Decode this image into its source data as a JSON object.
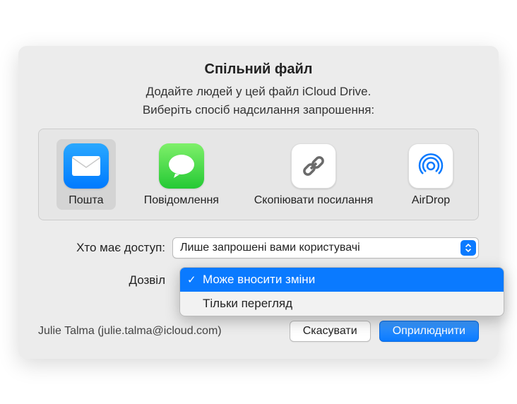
{
  "dialog": {
    "title": "Спільний файл",
    "subtitle": "Додайте людей у цей файл iCloud Drive.",
    "instruction": "Виберіть спосіб надсилання запрошення:"
  },
  "methods": [
    {
      "id": "mail",
      "label": "Пошта",
      "selected": true
    },
    {
      "id": "messages",
      "label": "Повідомлення",
      "selected": false
    },
    {
      "id": "copy-link",
      "label": "Скопіювати посилання",
      "selected": false
    },
    {
      "id": "airdrop",
      "label": "AirDrop",
      "selected": false
    }
  ],
  "access": {
    "label": "Хто має доступ:",
    "value": "Лише запрошені вами користувачі"
  },
  "permission": {
    "label": "Дозвіл",
    "options": [
      {
        "label": "Може вносити зміни",
        "selected": true
      },
      {
        "label": "Тільки перегляд",
        "selected": false
      }
    ]
  },
  "user": "Julie Talma (julie.talma@icloud.com)",
  "buttons": {
    "cancel": "Скасувати",
    "share": "Оприлюднити"
  }
}
